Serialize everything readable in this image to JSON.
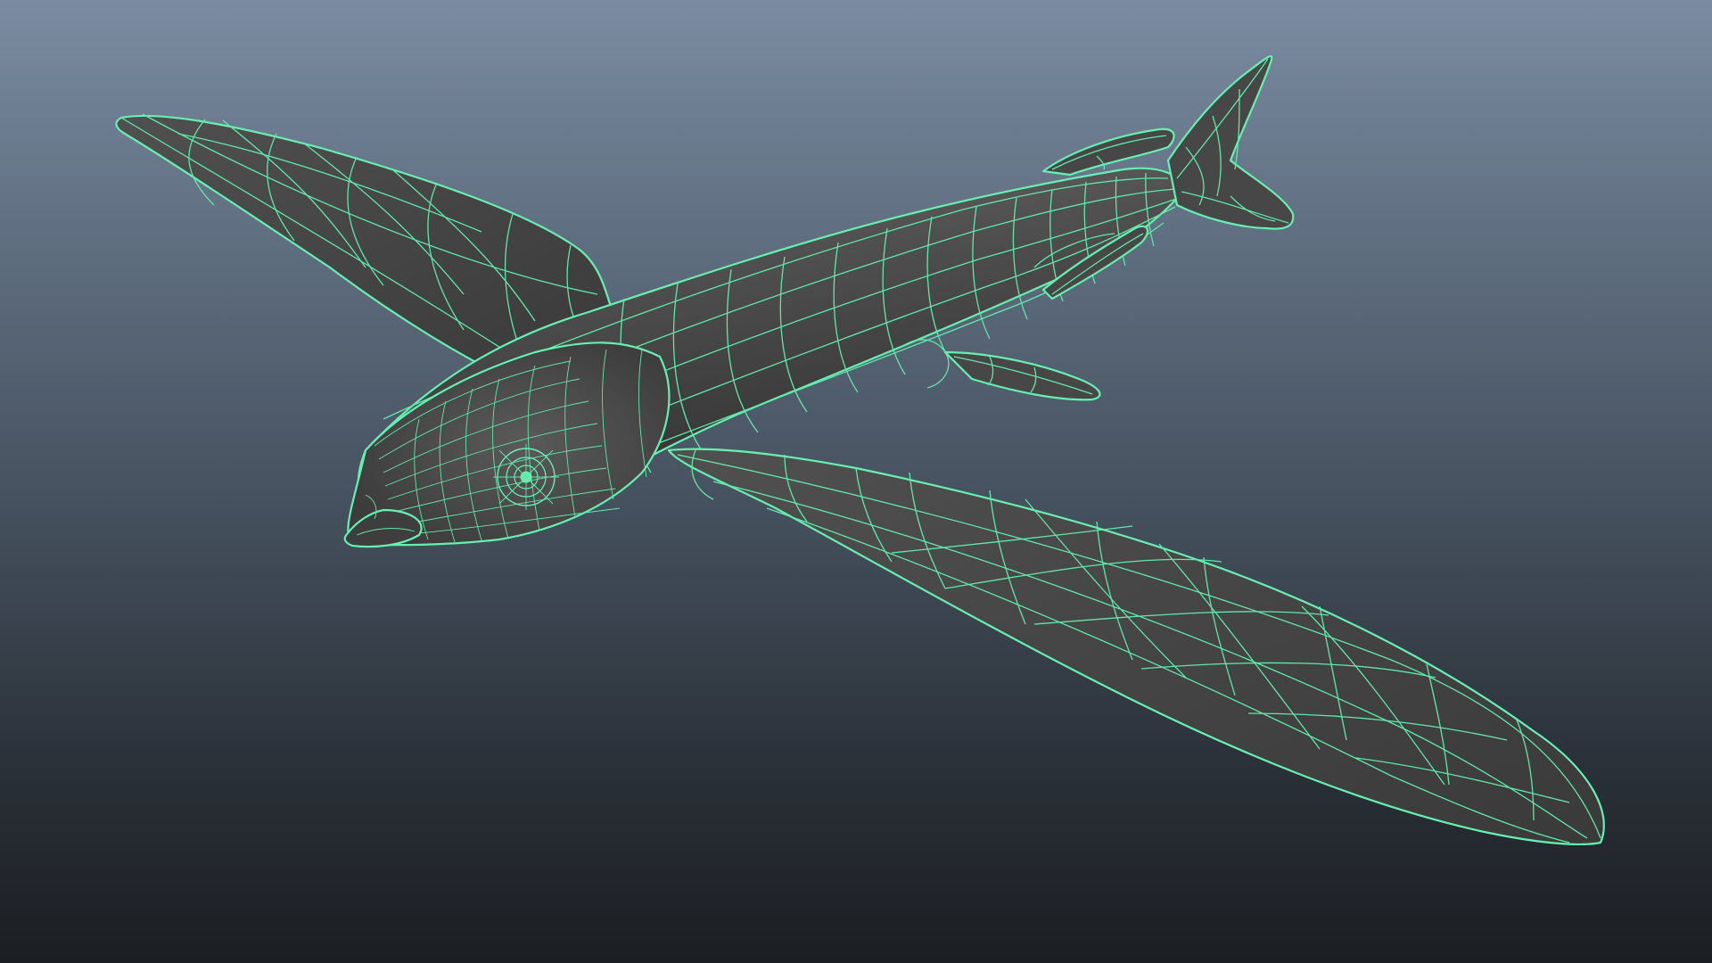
{
  "viewport": {
    "background_top": "#7b8ba1",
    "background_bottom": "#1b1e22",
    "display_mode": "wireframe-on-shaded",
    "wireframe_color": "#66f0b0",
    "shaded_color": "#444444"
  },
  "model": {
    "subject": "flying-fish",
    "parts": [
      "left-pectoral-fin",
      "right-pectoral-fin",
      "body",
      "head",
      "eye",
      "mouth",
      "dorsal-fin",
      "tail-fin",
      "pelvic-fin",
      "anal-fin"
    ]
  }
}
